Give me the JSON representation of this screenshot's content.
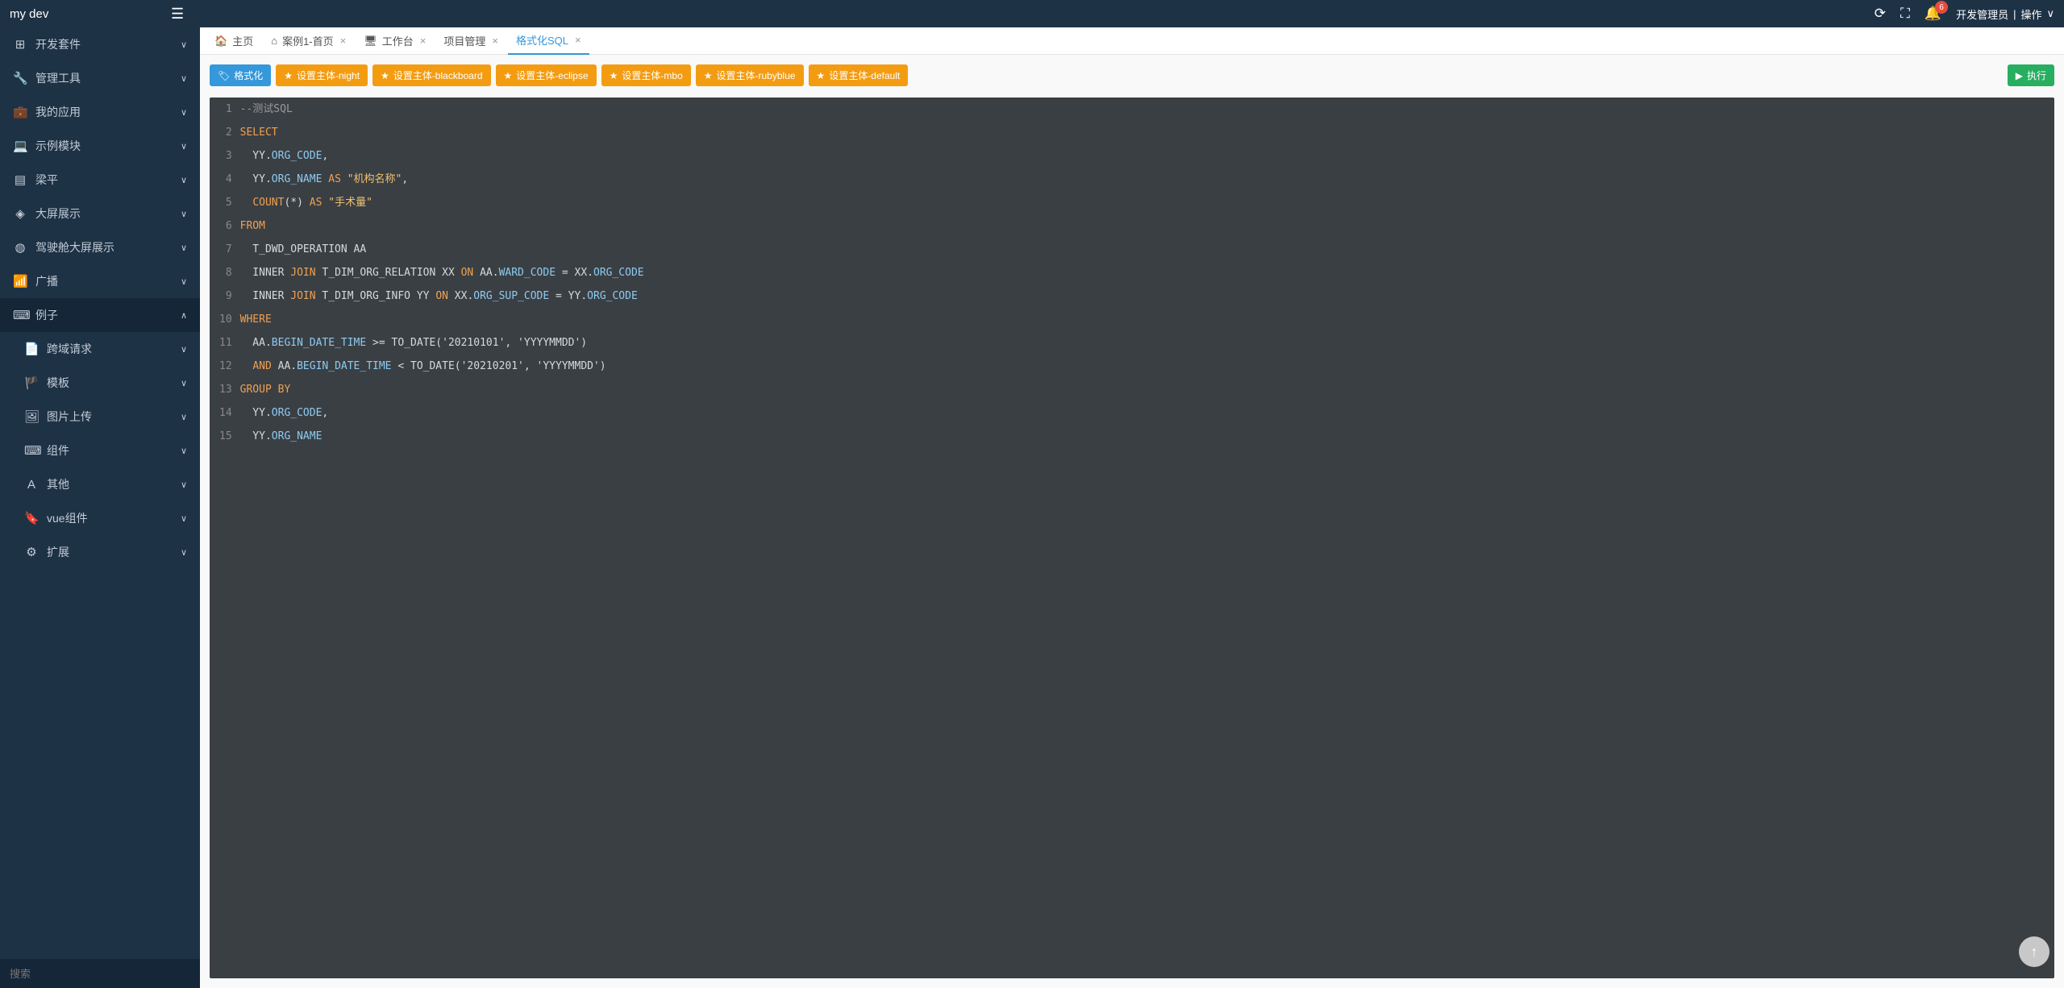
{
  "header": {
    "brand": "my dev",
    "badge": "6",
    "user": "开发管理员",
    "action": "操作"
  },
  "sidebar": {
    "items": [
      {
        "icon": "⊞",
        "label": "开发套件",
        "chev": "∨"
      },
      {
        "icon": "🔧",
        "label": "管理工具",
        "chev": "∨"
      },
      {
        "icon": "💼",
        "label": "我的应用",
        "chev": "∨"
      },
      {
        "icon": "💻",
        "label": "示例模块",
        "chev": "∨"
      },
      {
        "icon": "▤",
        "label": "梁平",
        "chev": "∨"
      },
      {
        "icon": "◈",
        "label": "大屏展示",
        "chev": "∨"
      },
      {
        "icon": "◍",
        "label": "驾驶舱大屏展示",
        "chev": "∨"
      },
      {
        "icon": "📶",
        "label": "广播",
        "chev": "∨"
      },
      {
        "icon": "⌨",
        "label": "例子",
        "chev": "∧",
        "expanded": true
      },
      {
        "icon": "📄",
        "label": "跨域请求",
        "chev": "∨",
        "sub": true
      },
      {
        "icon": "🏴",
        "label": "模板",
        "chev": "∨",
        "sub": true
      },
      {
        "icon": "🖼",
        "label": "图片上传",
        "chev": "∨",
        "sub": true
      },
      {
        "icon": "⌨",
        "label": "组件",
        "chev": "∨",
        "sub": true
      },
      {
        "icon": "A",
        "label": "其他",
        "chev": "∨",
        "sub": true
      },
      {
        "icon": "🔖",
        "label": "vue组件",
        "chev": "∨",
        "sub": true
      },
      {
        "icon": "⚙",
        "label": "扩展",
        "chev": "∨",
        "sub": true
      }
    ],
    "search_placeholder": "搜索"
  },
  "tabs": [
    {
      "icon": "🏠",
      "label": "主页",
      "closable": false,
      "active": false,
      "home": true
    },
    {
      "icon": "⌂",
      "label": "案例1-首页",
      "closable": true,
      "active": false
    },
    {
      "icon": "🖥",
      "label": "工作台",
      "closable": true,
      "active": false
    },
    {
      "icon": "",
      "label": "项目管理",
      "closable": true,
      "active": false
    },
    {
      "icon": "",
      "label": "格式化SQL",
      "closable": true,
      "active": true
    }
  ],
  "toolbar": {
    "format": "格式化",
    "theme_night": "设置主体-night",
    "theme_blackboard": "设置主体-blackboard",
    "theme_eclipse": "设置主体-eclipse",
    "theme_mbo": "设置主体-mbo",
    "theme_rubyblue": "设置主体-rubyblue",
    "theme_default": "设置主体-default",
    "execute": "执行"
  },
  "editor": {
    "line_count": 15,
    "content": [
      {
        "n": 1,
        "html": "<span class='cm'>--测试SQL</span>"
      },
      {
        "n": 2,
        "html": "<span class='kw'>SELECT</span>"
      },
      {
        "n": 3,
        "html": "  YY.<span class='fld'>ORG_CODE</span>,"
      },
      {
        "n": 4,
        "html": "  YY.<span class='fld'>ORG_NAME</span> <span class='kw'>AS</span> <span class='str'>\"机构名称\"</span>,"
      },
      {
        "n": 5,
        "html": "  <span class='kw'>COUNT</span>(*) <span class='kw'>AS</span> <span class='str'>\"手术量\"</span>"
      },
      {
        "n": 6,
        "html": "<span class='kw'>FROM</span>"
      },
      {
        "n": 7,
        "html": "  T_DWD_OPERATION AA"
      },
      {
        "n": 8,
        "html": "  INNER <span class='kw'>JOIN</span> T_DIM_ORG_RELATION XX <span class='kw'>ON</span> AA.<span class='fld'>WARD_CODE</span> = XX.<span class='fld'>ORG_CODE</span>"
      },
      {
        "n": 9,
        "html": "  INNER <span class='kw'>JOIN</span> T_DIM_ORG_INFO YY <span class='kw'>ON</span> XX.<span class='fld'>ORG_SUP_CODE</span> = YY.<span class='fld'>ORG_CODE</span>"
      },
      {
        "n": 10,
        "html": "<span class='kw'>WHERE</span>"
      },
      {
        "n": 11,
        "html": "  AA.<span class='fld'>BEGIN_DATE_TIME</span> &gt;= TO_DATE('20210101', 'YYYYMMDD')"
      },
      {
        "n": 12,
        "html": "  <span class='kw'>AND</span> AA.<span class='fld'>BEGIN_DATE_TIME</span> &lt; TO_DATE('20210201', 'YYYYMMDD')"
      },
      {
        "n": 13,
        "html": "<span class='kw'>GROUP</span> <span class='kw'>BY</span>"
      },
      {
        "n": 14,
        "html": "  YY.<span class='fld'>ORG_CODE</span>,"
      },
      {
        "n": 15,
        "html": "  YY.<span class='fld'>ORG_NAME</span>"
      }
    ]
  }
}
